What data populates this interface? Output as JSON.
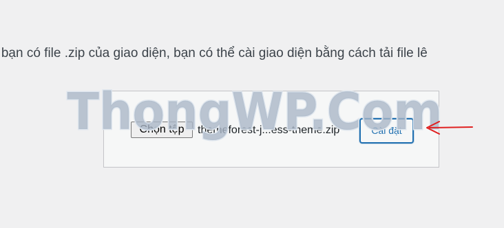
{
  "instruction": {
    "text": "u bạn có file .zip của giao diện, bạn có thể cài giao diện bằng cách tải file lê"
  },
  "upload_form": {
    "choose_file_label": "Chọn tệp",
    "file_name": "themeforest-j...ess-theme.zip",
    "install_label": "Cài đặt"
  },
  "watermark": {
    "text": "ThongWP.Com"
  },
  "colors": {
    "accent": "#2271b1",
    "annotation": "#e02020"
  }
}
